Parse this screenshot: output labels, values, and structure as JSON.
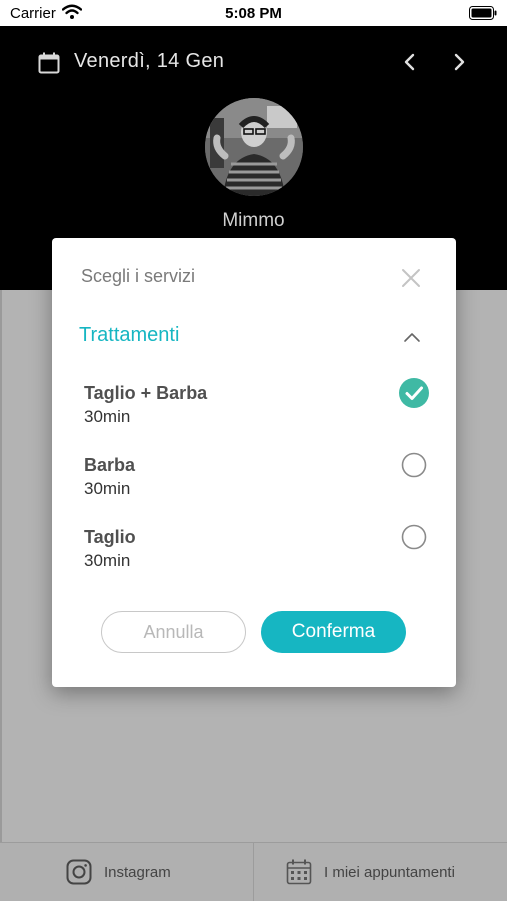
{
  "status_bar": {
    "carrier": "Carrier",
    "time": "5:08 PM"
  },
  "header": {
    "date": "Venerdì, 14 Gen",
    "name": "Mimmo"
  },
  "modal": {
    "title": "Scegli i servizi",
    "section_title": "Trattamenti",
    "services": [
      {
        "name": "Taglio + Barba",
        "duration": "30min",
        "selected": true
      },
      {
        "name": "Barba",
        "duration": "30min",
        "selected": false
      },
      {
        "name": "Taglio",
        "duration": "30min",
        "selected": false
      }
    ],
    "cancel_label": "Annulla",
    "confirm_label": "Conferma"
  },
  "bottom_bar": {
    "instagram_label": "Instagram",
    "appointments_label": "I miei appuntamenti"
  },
  "colors": {
    "accent": "#16b6c2",
    "header_bg": "#000000",
    "overlay_bg": "#b3b3b3"
  },
  "icons": [
    "wifi-icon",
    "battery-icon",
    "calendar-icon",
    "chevron-left-icon",
    "chevron-right-icon",
    "close-icon",
    "chevron-up-icon",
    "check-circle-icon",
    "radio-empty-icon",
    "instagram-icon",
    "calendar-grid-icon"
  ]
}
